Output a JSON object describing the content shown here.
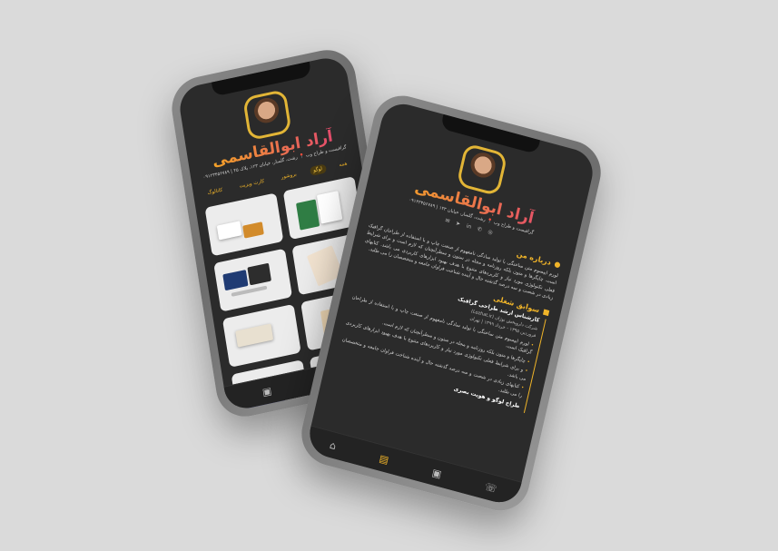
{
  "profile": {
    "name": "آراد ابوالقاسمی",
    "subline_left": "گرافیست و طراح وب 📍 رشت، گلسار، خیابان ۱۲۳، پلاک ۴۵ | ۰۹۱۲۳۴۵۶۷۸۹",
    "subline_right": "گرافیست و طراح وب 📍 رشت، گلسار، خیابان ۱۲۳ | ۰۹۱۲۳۴۵۶۷۸۹"
  },
  "left_phone": {
    "tabs": [
      "همه",
      "لوگو",
      "بروشور",
      "کارت ویزیت",
      "کاتالوگ"
    ],
    "active_tab": 1
  },
  "right_phone": {
    "about_title": "درباره من",
    "about_text": "لورم ایپسوم متن ساختگی با تولید سادگی نامفهوم از صنعت چاپ و با استفاده از طراحان گرافیک است. چاپگرها و متون بلکه روزنامه و مجله در ستون و سطرآنچنان که لازم است و برای شرایط فعلی تکنولوژی مورد نیاز و کاربردهای متنوع با هدف بهبود ابزارهای کاربردی می باشد. کتابهای زیادی در شصت و سه درصد گذشته حال و آینده شناخت فراوان جامعه و متخصصان را می طلبد.",
    "experience_title": "سوابق شغلی",
    "job_title": "کارشناس ارشد طراحی گرافیک",
    "job_company": "شرکت داروپخش نوژان (Lozhat.ir)",
    "job_dates": "فروردین ۱۳۹۵ - خرداد ۱۳۹۹ | تهران",
    "bullets": [
      "لورم ایپسوم متن ساختگی با تولید سادگی نامفهوم از صنعت چاپ و با استفاده از طراحان گرافیک است.",
      "چاپگرها و متون بلکه روزنامه و مجله در ستون و سطرآنچنان که لازم است.",
      "و برای شرایط فعلی تکنولوژی مورد نیاز و کاربردهای متنوع با هدف بهبود ابزارهای کاربردی می باشد.",
      "کتابهای زیادی در شصت و سه درصد گذشته حال و آینده شناخت فراوان جامعه و متخصصان را می طلبد."
    ],
    "next_job_title": "طراح لوگو و هویت بصری"
  },
  "colors": {
    "accent": "#f0b429",
    "gradient_start": "#f5b21a",
    "gradient_end": "#e23b7a",
    "screen_bg": "#2b2b2b"
  },
  "icons": {
    "bottom_nav": [
      "phone-icon",
      "portfolio-icon",
      "resume-icon",
      "home-icon"
    ]
  }
}
